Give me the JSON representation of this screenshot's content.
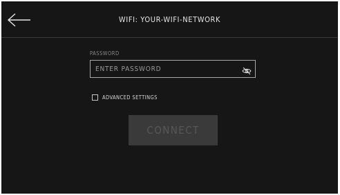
{
  "header": {
    "title": "WIFI: YOUR-WIFI-NETWORK",
    "back_icon": "arrow-left-icon"
  },
  "form": {
    "password_label": "PASSWORD",
    "password_value": "",
    "password_placeholder": "ENTER PASSWORD",
    "visibility_icon": "eye-slash-icon",
    "advanced_settings_label": "ADVANCED SETTINGS",
    "advanced_settings_checked": false,
    "connect_label": "CONNECT"
  },
  "colors": {
    "background": "#161616",
    "text": "#e6e6e6",
    "button_disabled": "#3a3a3a",
    "button_text_disabled": "#575757"
  }
}
